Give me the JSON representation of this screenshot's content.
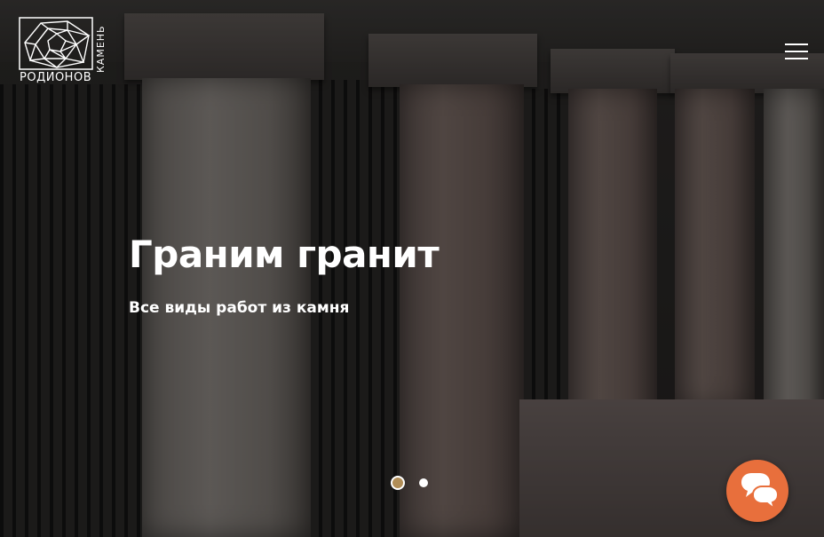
{
  "brand": {
    "name": "РОДИОНОВ",
    "tagline": "КАМЕНЬ"
  },
  "hero": {
    "title": "Граним гранит",
    "subtitle": "Все виды работ из камня"
  },
  "slider": {
    "slides_count": 2,
    "active_index": 0
  },
  "icons": {
    "menu": "hamburger-menu-icon",
    "chat": "chat-bubbles-icon",
    "logo": "geometric-stone-logo-icon"
  },
  "colors": {
    "accent": "#e86f3c",
    "active_dot": "#b08d57",
    "text": "#ffffff"
  }
}
